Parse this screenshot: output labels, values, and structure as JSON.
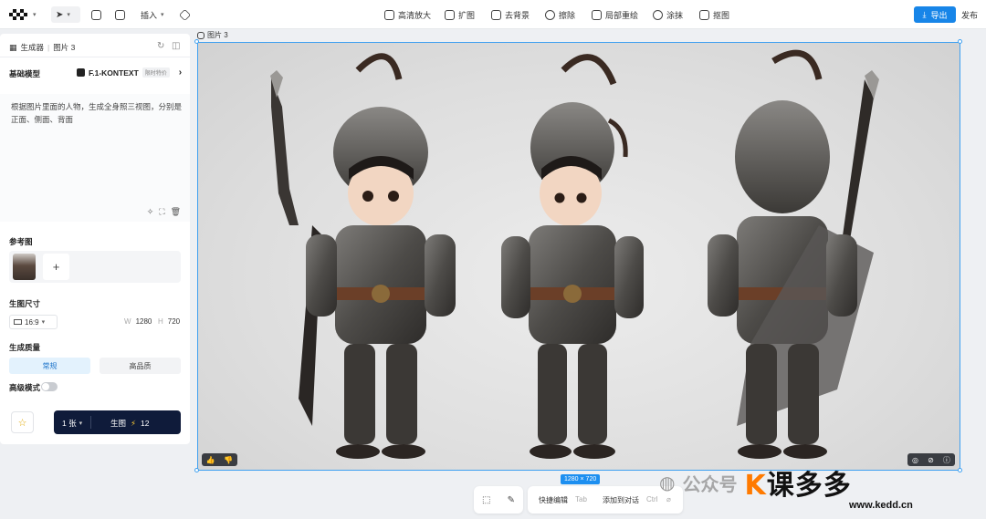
{
  "topbar": {
    "logo": "logo-icon",
    "tools": {
      "insert": "插入",
      "upscale": "高清放大",
      "expand": "扩图",
      "remove_bg": "去背景",
      "erase": "擦除",
      "inpaint": "局部重绘",
      "smear": "涂抹",
      "cutout": "抠图"
    },
    "export": "导出",
    "publish": "发布"
  },
  "panel": {
    "breadcrumb_tool": "生成器",
    "breadcrumb_sep": "|",
    "breadcrumb_item": "图片 3",
    "base_model_label": "基础模型",
    "model_name": "F.1-KONTEXT",
    "model_tag": "限时特价",
    "prompt": "根据图片里面的人物，生成全身照三视图，分别是正面、侧面、背面",
    "reference_label": "参考图",
    "size_label": "生图尺寸",
    "ratio": "16:9",
    "width_key": "W",
    "width": "1280",
    "height_key": "H",
    "height": "720",
    "quality_label": "生成质量",
    "quality_options": [
      "常规",
      "高品质"
    ],
    "quality_selected": "常规",
    "advanced_label": "高级模式",
    "advanced_enabled": false,
    "count": "1 张",
    "generate": "生图",
    "cost": "12"
  },
  "canvas": {
    "image_label": "图片 3",
    "image_size": "1280 × 720"
  },
  "bottom": {
    "quick_edit": "快捷编辑",
    "quick_edit_key": "Tab",
    "add_to_chat": "添加到对话",
    "add_to_chat_key": "Ctrl"
  },
  "watermark": {
    "wechat": "公众号",
    "brand": "课多多",
    "url": "www.kedd.cn"
  },
  "colors": {
    "accent": "#1785e8",
    "selection": "#3fa0f0",
    "generate_bg": "#0f1b3a"
  }
}
